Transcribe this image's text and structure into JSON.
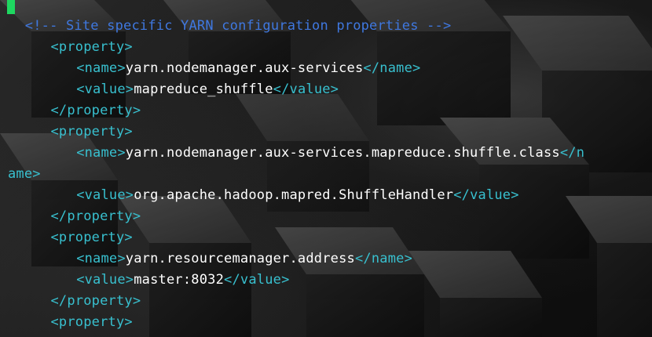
{
  "editor": {
    "lines": [
      {
        "indent": "  ",
        "parts": [
          {
            "t": "comment",
            "s": "<!-- Site specific YARN configuration properties -->"
          }
        ]
      },
      {
        "indent": "     ",
        "parts": [
          {
            "t": "tag",
            "s": "<property>"
          }
        ]
      },
      {
        "indent": "        ",
        "parts": [
          {
            "t": "tag",
            "s": "<name>"
          },
          {
            "t": "val",
            "s": "yarn.nodemanager.aux-services"
          },
          {
            "t": "tag",
            "s": "</name>"
          }
        ]
      },
      {
        "indent": "        ",
        "parts": [
          {
            "t": "tag",
            "s": "<value>"
          },
          {
            "t": "val",
            "s": "mapreduce_shuffle"
          },
          {
            "t": "tag",
            "s": "</value>"
          }
        ]
      },
      {
        "indent": "     ",
        "parts": [
          {
            "t": "tag",
            "s": "</property>"
          }
        ]
      },
      {
        "indent": "     ",
        "parts": [
          {
            "t": "tag",
            "s": "<property>"
          }
        ]
      },
      {
        "indent": "        ",
        "parts": [
          {
            "t": "tag",
            "s": "<name>"
          },
          {
            "t": "val",
            "s": "yarn.nodemanager.aux-services.mapreduce.shuffle.class"
          },
          {
            "t": "tag",
            "s": "</n"
          }
        ]
      },
      {
        "indent": "",
        "parts": [
          {
            "t": "tag",
            "s": "ame>"
          }
        ]
      },
      {
        "indent": "        ",
        "parts": [
          {
            "t": "tag",
            "s": "<value>"
          },
          {
            "t": "val",
            "s": "org.apache.hadoop.mapred.ShuffleHandler"
          },
          {
            "t": "tag",
            "s": "</value>"
          }
        ]
      },
      {
        "indent": "     ",
        "parts": [
          {
            "t": "tag",
            "s": "</property>"
          }
        ]
      },
      {
        "indent": "     ",
        "parts": [
          {
            "t": "tag",
            "s": "<property>"
          }
        ]
      },
      {
        "indent": "        ",
        "parts": [
          {
            "t": "tag",
            "s": "<name>"
          },
          {
            "t": "val",
            "s": "yarn.resourcemanager.address"
          },
          {
            "t": "tag",
            "s": "</name>"
          }
        ]
      },
      {
        "indent": "        ",
        "parts": [
          {
            "t": "tag",
            "s": "<value>"
          },
          {
            "t": "val",
            "s": "master:8032"
          },
          {
            "t": "tag",
            "s": "</value>"
          }
        ]
      },
      {
        "indent": "     ",
        "parts": [
          {
            "t": "tag",
            "s": "</property>"
          }
        ]
      },
      {
        "indent": "     ",
        "parts": [
          {
            "t": "tag",
            "s": "<property>"
          }
        ]
      }
    ]
  },
  "colors": {
    "comment": "#3f78e0",
    "tag": "#38c0cf",
    "value": "#ffffff",
    "cursor": "#1ed760"
  }
}
